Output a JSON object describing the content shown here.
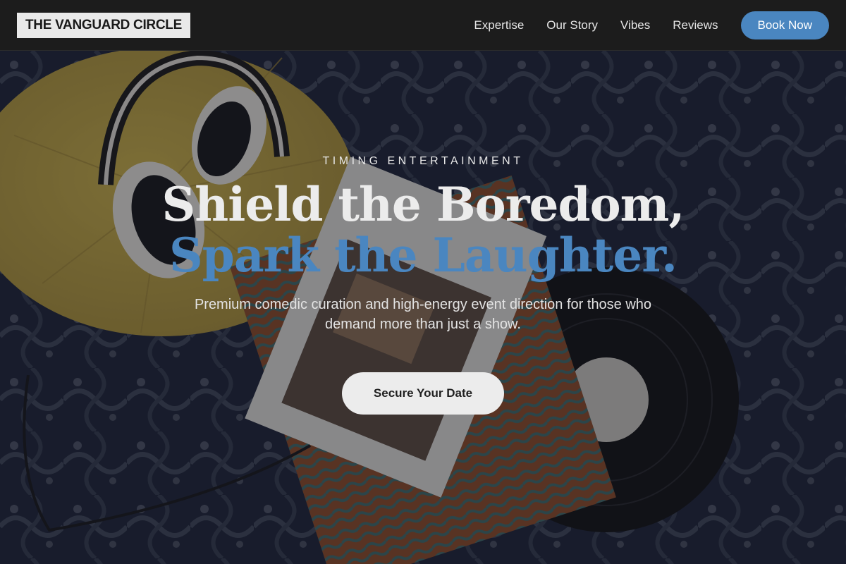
{
  "nav": {
    "logo": "THE VANGUARD CIRCLE",
    "links": [
      "Expertise",
      "Our Story",
      "Vibes",
      "Reviews"
    ],
    "book_label": "Book Now"
  },
  "hero": {
    "kicker": "TIMING ENTERTAINMENT",
    "headline_line1": "Shield the Boredom,",
    "headline_line2": "Spark the Laughter.",
    "subtitle": "Premium comedic curation and high-energy event direction for those who demand more than just a show.",
    "cta_label": "Secure Your Date"
  },
  "colors": {
    "accent": "#4a86c0",
    "nav_bg": "#1c1c1c",
    "logo_bg": "#e9e9e9",
    "cta_bg": "#ececec"
  }
}
